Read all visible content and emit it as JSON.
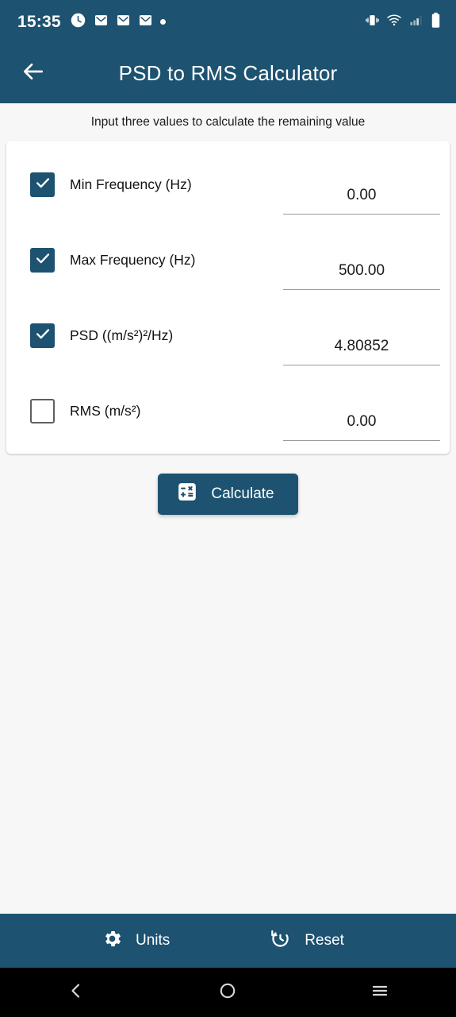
{
  "status_bar": {
    "time": "15:35",
    "left_icons": [
      "clock-icon",
      "mail-icon",
      "mail-icon",
      "mail-icon",
      "dot-icon"
    ],
    "right_icons": [
      "vibrate-icon",
      "wifi-icon",
      "cellular-signal-icon",
      "battery-icon"
    ]
  },
  "app_bar": {
    "back_icon": "arrow-left-icon",
    "title": "PSD to RMS Calculator"
  },
  "main": {
    "subtitle": "Input three values to calculate the remaining value",
    "rows": [
      {
        "label": "Min Frequency (Hz)",
        "value": "0.00",
        "checked": true
      },
      {
        "label": "Max Frequency (Hz)",
        "value": "500.00",
        "checked": true
      },
      {
        "label": "PSD ((m/s²)²/Hz)",
        "value": "4.80852",
        "checked": true
      },
      {
        "label": "RMS (m/s²)",
        "value": "0.00",
        "checked": false
      }
    ],
    "calculate_button": {
      "label": "Calculate",
      "icon": "calculator-icon"
    }
  },
  "bottom_bar": {
    "units_label": "Units",
    "units_icon": "gear-icon",
    "reset_label": "Reset",
    "reset_icon": "history-restore-icon"
  },
  "nav_bar": {
    "back_icon": "chevron-left-icon",
    "home_icon": "circle-icon",
    "recents_icon": "hamburger-icon"
  },
  "colors": {
    "primary": "#1d5270",
    "background": "#f7f7f8",
    "card": "#ffffff",
    "nav_bar": "#000000",
    "text": "#121212"
  }
}
